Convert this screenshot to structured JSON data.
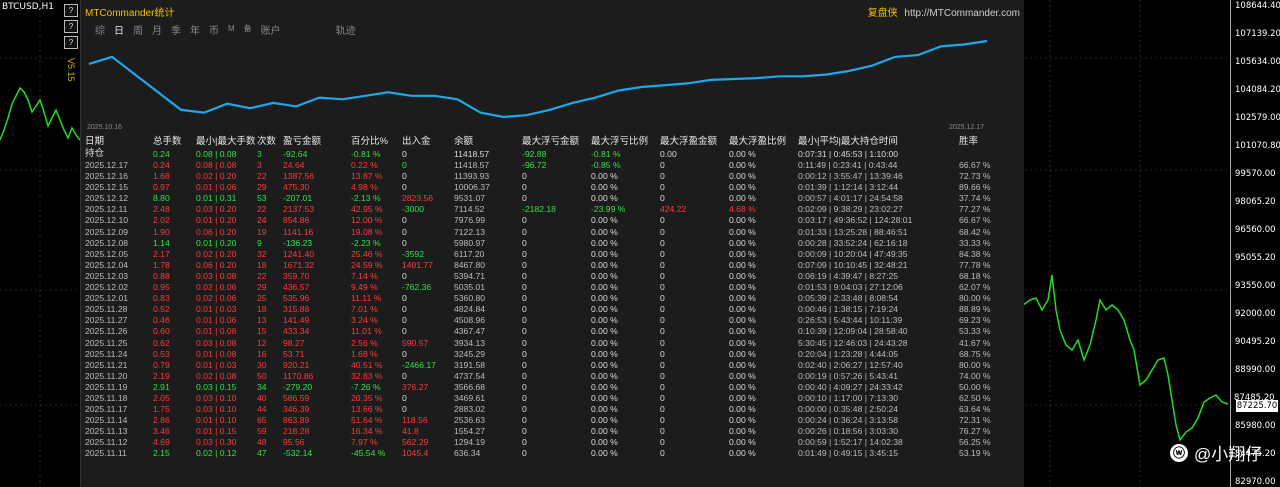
{
  "window": {
    "symbol": "BTCUSD,H1",
    "version": "V5.15",
    "side_buttons": [
      "?",
      "?",
      "?",
      "?"
    ]
  },
  "price_axis": {
    "ticks": [
      "108644.40",
      "107139.20",
      "105634.00",
      "104084.20",
      "102579.00",
      "101070.80",
      "99570.00",
      "98065.20",
      "96560.00",
      "95055.20",
      "93550.00",
      "92000.00",
      "90495.20",
      "88990.00",
      "87485.20",
      "85980.00",
      "84475.20",
      "82970.00"
    ],
    "current": "87225.70"
  },
  "panel": {
    "title": "MTCommander统计",
    "brand": "复盘侠",
    "url": "http://MTCommander.com",
    "tabs": [
      "综",
      "日",
      "周",
      "月",
      "季",
      "年",
      "币",
      "M",
      "备",
      "账户",
      "轨迹"
    ],
    "active_tab": "日",
    "equity_start_date": "2025.10.16",
    "equity_end_date": "2025.12.17",
    "equity_line": [
      60,
      68,
      48,
      28,
      8,
      5,
      15,
      10,
      16,
      12,
      22,
      20,
      24,
      28,
      24,
      24,
      20,
      5,
      0,
      2,
      8,
      16,
      22,
      30,
      34,
      36,
      38,
      42,
      43,
      44,
      46,
      46,
      48,
      52,
      58,
      68,
      70,
      80,
      82,
      86
    ],
    "headers": [
      "日期",
      "总手数",
      "最小|最大手数",
      "次数",
      "盈亏金额",
      "百分比%",
      "出入金",
      "余额",
      "最大浮亏金额",
      "最大浮亏比例",
      "最大浮盈金额",
      "最大浮盈比例",
      "最小|平均|最大持仓时间",
      "胜率"
    ],
    "position_row": {
      "label": "持仓",
      "lots": "0.24",
      "minmax": "0.08 | 0.08",
      "count": "3",
      "pnl": "-92.64",
      "pct": "-0.81 %",
      "io": "0",
      "balance": "11418.57",
      "mdd": "-92.88",
      "mddp": "-0.81 %",
      "mfe": "0.00",
      "mfep": "0.00 %",
      "hold": "0:07:31 | 0:45:53 | 1:10:00",
      "win": ""
    },
    "rows": [
      [
        "2025.12.17",
        "0.24",
        "0.08 | 0.08",
        "3",
        "24.64",
        "0.22 %",
        "0",
        "11418.57",
        "-96.72",
        "-0.85 %",
        "0",
        "0.00 %",
        "0:11:49 | 0:23:41 | 0:43:44",
        "66.67 %",
        "r",
        "g"
      ],
      [
        "2025.12.16",
        "1.68",
        "0.02 | 0.20",
        "22",
        "1387.56",
        "13.87 %",
        "0",
        "11393.93",
        "0",
        "0.00 %",
        "0",
        "0.00 %",
        "0:00:12 | 3:55:47 | 13:39:46",
        "72.73 %",
        "r",
        "w"
      ],
      [
        "2025.12.15",
        "0.97",
        "0.01 | 0.06",
        "29",
        "475.30",
        "4.98 %",
        "0",
        "10006.37",
        "0",
        "0.00 %",
        "0",
        "0.00 %",
        "0:01:39 | 1:12:14 | 3:12:44",
        "89.66 %",
        "r",
        "w"
      ],
      [
        "2025.12.12",
        "8.80",
        "0.01 | 0.31",
        "53",
        "-207.01",
        "-2.13 %",
        "2823.56",
        "9531.07",
        "0",
        "0.00 %",
        "0",
        "0.00 %",
        "0:00:57 | 4:01:17 | 24:54:58",
        "37.74 %",
        "g",
        "r"
      ],
      [
        "2025.12.11",
        "2.48",
        "0.03 | 0.20",
        "22",
        "2137.53",
        "42.95 %",
        "-3000",
        "7114.52",
        "-2182.18",
        "-23.99 %",
        "424.22",
        "4.68 %",
        "0:02:09 | 9:38:29 | 23:02:27",
        "77.27 %",
        "r",
        "g"
      ],
      [
        "2025.12.10",
        "2.02",
        "0.01 | 0.20",
        "24",
        "854.86",
        "12.00 %",
        "0",
        "7976.99",
        "0",
        "0.00 %",
        "0",
        "0.00 %",
        "0:03:17 | 49:36:52 | 124:28:01",
        "66.67 %",
        "r",
        "w"
      ],
      [
        "2025.12.09",
        "1.90",
        "0.06 | 0.20",
        "19",
        "1141.16",
        "19.08 %",
        "0",
        "7122.13",
        "0",
        "0.00 %",
        "0",
        "0.00 %",
        "0:01:33 | 13:25:28 | 88:46:51",
        "68.42 %",
        "r",
        "w"
      ],
      [
        "2025.12.08",
        "1.14",
        "0.01 | 0.20",
        "9",
        "-136.23",
        "-2.23 %",
        "0",
        "5980.97",
        "0",
        "0.00 %",
        "0",
        "0.00 %",
        "0:00:28 | 33:52:24 | 62:16:18",
        "33.33 %",
        "g",
        "w"
      ],
      [
        "2025.12.05",
        "2.17",
        "0.02 | 0.20",
        "32",
        "1241.40",
        "25.46 %",
        "-3592",
        "6117.20",
        "0",
        "0.00 %",
        "0",
        "0.00 %",
        "0:00:09 | 10:20:04 | 47:49:35",
        "84.38 %",
        "r",
        "g"
      ],
      [
        "2025.12.04",
        "1.78",
        "0.06 | 0.20",
        "18",
        "1671.32",
        "24.59 %",
        "1401.77",
        "8467.80",
        "0",
        "0.00 %",
        "0",
        "0.00 %",
        "0:07:09 | 10:10:45 | 32:48:21",
        "77.78 %",
        "r",
        "r"
      ],
      [
        "2025.12.03",
        "0.88",
        "0.03 | 0.08",
        "22",
        "359.70",
        "7.14 %",
        "0",
        "5394.71",
        "0",
        "0.00 %",
        "0",
        "0.00 %",
        "0:06:19 | 4:39:47 | 8:27:25",
        "68.18 %",
        "r",
        "w"
      ],
      [
        "2025.12.02",
        "0.95",
        "0.02 | 0.06",
        "29",
        "436.57",
        "9.49 %",
        "-762.36",
        "5035.01",
        "0",
        "0.00 %",
        "0",
        "0.00 %",
        "0:01:53 | 9:04:03 | 27:12:06",
        "62.07 %",
        "r",
        "g"
      ],
      [
        "2025.12.01",
        "0.83",
        "0.02 | 0.06",
        "25",
        "535.96",
        "11.11 %",
        "0",
        "5360.80",
        "0",
        "0.00 %",
        "0",
        "0.00 %",
        "0:05:39 | 2:33:48 | 8:08:54",
        "80.00 %",
        "r",
        "w"
      ],
      [
        "2025.11.28",
        "0.52",
        "0.01 | 0.03",
        "18",
        "315.88",
        "7.01 %",
        "0",
        "4824.84",
        "0",
        "0.00 %",
        "0",
        "0.00 %",
        "0:00:46 | 1:38:15 | 7:19:24",
        "88.89 %",
        "r",
        "w"
      ],
      [
        "2025.11.27",
        "0.46",
        "0.01 | 0.06",
        "13",
        "141.49",
        "3.24 %",
        "0",
        "4508.96",
        "0",
        "0.00 %",
        "0",
        "0.00 %",
        "0:26:53 | 5:43:44 | 10:11:39",
        "69.23 %",
        "r",
        "w"
      ],
      [
        "2025.11.26",
        "0.60",
        "0.01 | 0.08",
        "15",
        "433.34",
        "11.01 %",
        "0",
        "4367.47",
        "0",
        "0.00 %",
        "0",
        "0.00 %",
        "0:10:39 | 12:09:04 | 28:58:40",
        "53.33 %",
        "r",
        "w"
      ],
      [
        "2025.11.25",
        "0.62",
        "0.03 | 0.08",
        "12",
        "98.27",
        "2.56 %",
        "590.57",
        "3934.13",
        "0",
        "0.00 %",
        "0",
        "0.00 %",
        "5:30:45 | 12:46:03 | 24:43:28",
        "41.67 %",
        "r",
        "r"
      ],
      [
        "2025.11.24",
        "0.53",
        "0.01 | 0.08",
        "16",
        "53.71",
        "1.68 %",
        "0",
        "3245.29",
        "0",
        "0.00 %",
        "0",
        "0.00 %",
        "0:20:04 | 1:23:28 | 4:44:05",
        "68.75 %",
        "r",
        "w"
      ],
      [
        "2025.11.21",
        "0.79",
        "0.01 | 0.03",
        "30",
        "920.21",
        "40.51 %",
        "-2466.17",
        "3191.58",
        "0",
        "0.00 %",
        "0",
        "0.00 %",
        "0:02:40 | 2:06:27 | 12:57:40",
        "80.00 %",
        "r",
        "g"
      ],
      [
        "2025.11.20",
        "2.19",
        "0.02 | 0.08",
        "50",
        "1170.86",
        "32.83 %",
        "0",
        "4737.54",
        "0",
        "0.00 %",
        "0",
        "0.00 %",
        "0:00:19 | 0:57:26 | 5:43:41",
        "74.00 %",
        "r",
        "w"
      ],
      [
        "2025.11.19",
        "2.91",
        "0.03 | 0.15",
        "34",
        "-279.20",
        "-7.26 %",
        "376.27",
        "3566.68",
        "0",
        "0.00 %",
        "0",
        "0.00 %",
        "0:00:40 | 4:09:27 | 24:33:42",
        "50.00 %",
        "g",
        "r"
      ],
      [
        "2025.11.18",
        "2.05",
        "0.03 | 0.10",
        "40",
        "586.59",
        "20.35 %",
        "0",
        "3469.61",
        "0",
        "0.00 %",
        "0",
        "0.00 %",
        "0:00:10 | 1:17:00 | 7:13:30",
        "62.50 %",
        "r",
        "w"
      ],
      [
        "2025.11.17",
        "1.75",
        "0.03 | 0.10",
        "44",
        "346.39",
        "13.66 %",
        "0",
        "2883.02",
        "0",
        "0.00 %",
        "0",
        "0.00 %",
        "0:00:00 | 0:35:48 | 2:50:24",
        "63.64 %",
        "r",
        "w"
      ],
      [
        "2025.11.14",
        "2.86",
        "0.01 | 0.10",
        "65",
        "863.89",
        "51.64 %",
        "118.56",
        "2536.63",
        "0",
        "0.00 %",
        "0",
        "0.00 %",
        "0:00:24 | 0:36:24 | 3:13:58",
        "72.31 %",
        "r",
        "r"
      ],
      [
        "2025.11.13",
        "3.46",
        "0.01 | 0.15",
        "59",
        "218.28",
        "16.34 %",
        "41.8",
        "1554.27",
        "0",
        "0.00 %",
        "0",
        "0.00 %",
        "0:00:26 | 0:18:56 | 3:03:30",
        "76.27 %",
        "r",
        "r"
      ],
      [
        "2025.11.12",
        "4.69",
        "0.03 | 0.30",
        "48",
        "95.56",
        "7.97 %",
        "562.29",
        "1294.19",
        "0",
        "0.00 %",
        "0",
        "0.00 %",
        "0:00:59 | 1:52:17 | 14:02:38",
        "56.25 %",
        "r",
        "r"
      ],
      [
        "2025.11.11",
        "2.15",
        "0.02 | 0.12",
        "47",
        "-532.14",
        "-45.54 %",
        "1045.4",
        "636.34",
        "0",
        "0.00 %",
        "0",
        "0.00 %",
        "0:01:49 | 0:49:15 | 3:45:15",
        "53.19 %",
        "g",
        "r"
      ]
    ]
  },
  "watermark": {
    "icon": "weibo-icon",
    "text": "@小翔仔"
  }
}
